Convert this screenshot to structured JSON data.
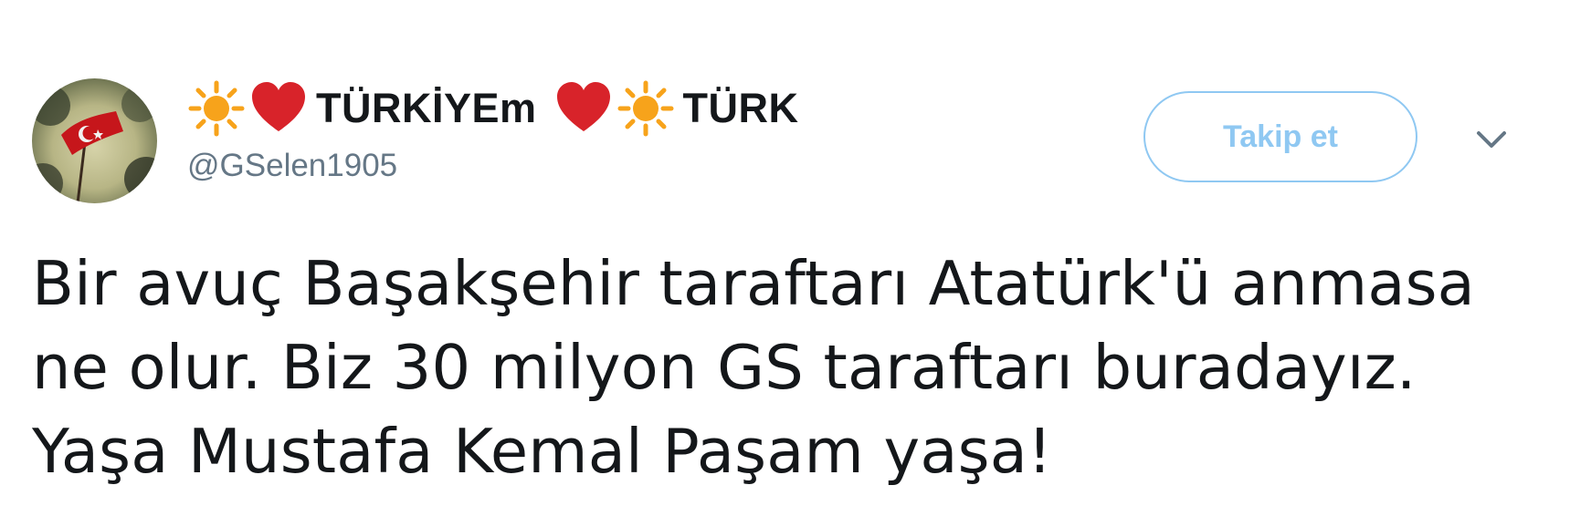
{
  "user": {
    "display_name_part1": "TÜRKİYEm",
    "display_name_part2": "TÜRK",
    "handle": "@GSelen1905",
    "avatar_icon": "turkish-flag-avatar",
    "emoji_icons": [
      "sun-emoji",
      "red-heart-emoji",
      "red-heart-emoji",
      "sun-emoji"
    ]
  },
  "actions": {
    "follow_label": "Takip et",
    "menu_icon": "chevron-down-icon"
  },
  "tweet": {
    "lines": [
      "Bir avuç Başakşehir taraftarı Atatürk'ü anmasa",
      "ne olur. Biz 30 milyon GS taraftarı buradayız.",
      "Yaşa Mustafa Kemal Paşam yaşa!"
    ]
  },
  "colors": {
    "text": "#14171a",
    "secondary": "#657786",
    "follow_accent": "#8fc8f2",
    "heart": "#d8232a",
    "sun": "#f7a31b"
  }
}
